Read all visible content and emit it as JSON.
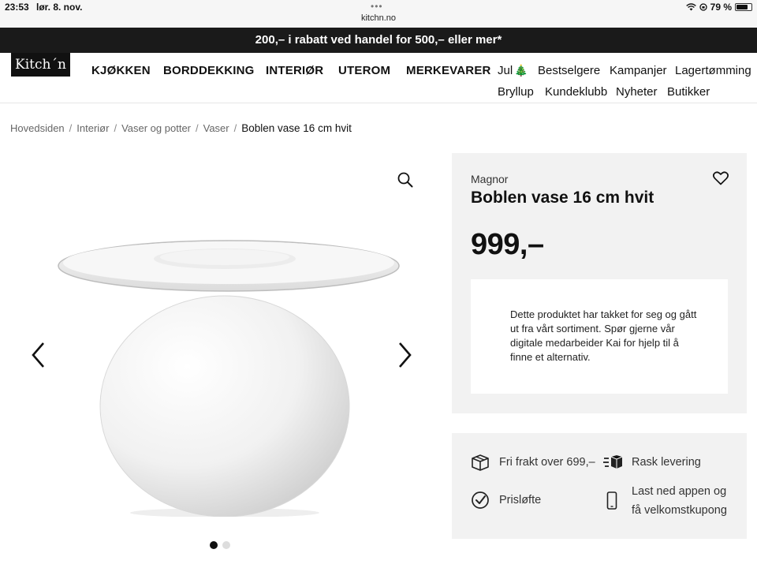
{
  "status": {
    "time": "23:53",
    "date": "lør. 8. nov.",
    "url": "kitchn.no",
    "battery": "79 %",
    "battery_level": 0.79
  },
  "promo": {
    "text": "200,– i rabatt ved handel for 500,– eller mer*"
  },
  "header": {
    "logo": "Kitch´n",
    "main_nav": [
      "KJØKKEN",
      "BORDDEKKING",
      "INTERIØR",
      "UTEROM",
      "MERKEVARER"
    ],
    "secondary_nav": [
      "Jul",
      "Bestselgere",
      "Kampanjer",
      "Lagertømming",
      "Bryllup",
      "Kundeklubb",
      "Nyheter",
      "Butikker"
    ],
    "tree_emoji": "🎄"
  },
  "breadcrumb": {
    "items": [
      "Hovedsiden",
      "Interiør",
      "Vaser og potter",
      "Vaser"
    ],
    "current": "Boblen vase 16 cm hvit",
    "separator": "/"
  },
  "product": {
    "brand": "Magnor",
    "title": "Boblen vase 16 cm hvit",
    "price": "999,–",
    "notice": "Dette produktet har takket for seg og gått ut fra vårt sortiment. Spør gjerne vår digitale medarbeider Kai for hjelp til å finne et alternativ."
  },
  "gallery": {
    "image_count": 2,
    "active_index": 0
  },
  "info": {
    "shipping": "Fri frakt over 699,–",
    "delivery": "Rask levering",
    "price_promise": "Prisløfte",
    "app_line1": "Last ned appen og",
    "app_line2": "få velkomstkupong"
  },
  "colors": {
    "promo_bg": "#1a1a1a",
    "panel_bg": "#f2f2f2",
    "text": "#111111"
  }
}
